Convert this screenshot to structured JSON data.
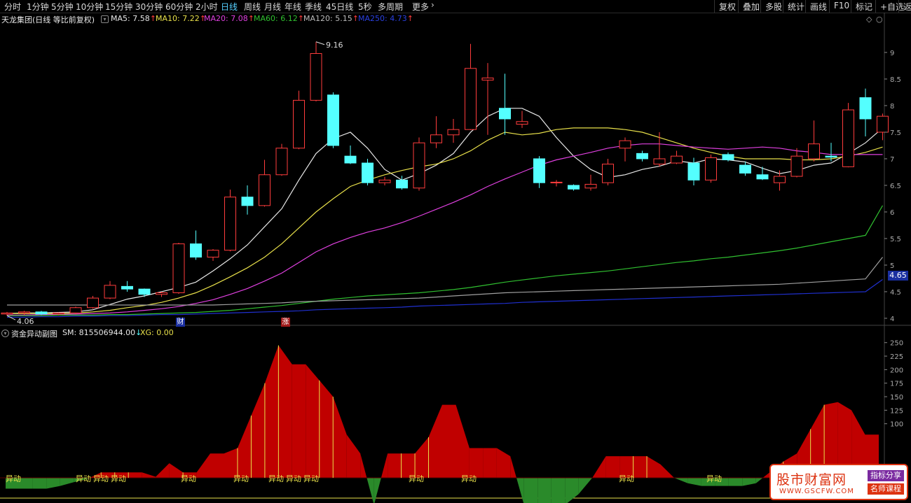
{
  "toolbar": {
    "periods": [
      "分时",
      "1分钟",
      "5分钟",
      "10分钟",
      "15分钟",
      "30分钟",
      "60分钟",
      "2小时",
      "日线",
      "周线",
      "月线",
      "年线",
      "季线",
      "45日线",
      "5秒",
      "多周期",
      "更多"
    ],
    "active_period": "日线",
    "right_buttons": [
      "复权",
      "叠加",
      "多股",
      "统计",
      "画线",
      "F10",
      "标记",
      "+自选",
      "返"
    ]
  },
  "legend": {
    "stock": "天龙集团(日线 等比前复权)",
    "ma5": "MA5: 7.58",
    "ma10": "MA10: 7.22",
    "ma20": "MA20: 7.08",
    "ma60": "MA60: 6.12",
    "ma120": "MA120: 5.15",
    "ma250": "MA250: 4.73",
    "up_arrow": "↑"
  },
  "annotations": {
    "high_label": "9.16",
    "low_label": "4.06",
    "price_tag": "4.65",
    "flag_cai": "财",
    "flag_zhang": "涨"
  },
  "sub_legend": {
    "name": "资金异动副图",
    "sm": "SM: 815506944.00",
    "sm_arrow": "↓",
    "xg": "XG: 0.00"
  },
  "signal_label": "异动",
  "watermark": {
    "title": "股市财富网",
    "url": "WWW.GSCFW.COM",
    "tag1": "指标分享",
    "tag2": "名师课程"
  },
  "colors": {
    "up": "#ff3c3c",
    "down": "#54ffff",
    "ma5": "#e8e8e8",
    "ma10": "#e8e04a",
    "ma20": "#e040e0",
    "ma60": "#30c030",
    "ma120": "#a0a0a0",
    "ma250": "#2030d0",
    "area_pos": "#c00000",
    "area_neg": "#2a8a2a"
  },
  "chart_data": [
    {
      "type": "candlestick",
      "title": "天龙集团(日线 等比前复权)",
      "y_ticks": [
        9,
        8.5,
        8,
        7.5,
        7,
        6.5,
        6,
        5.5,
        5,
        4.5,
        4
      ],
      "ylim": [
        3.96,
        9.46
      ],
      "candles": [
        [
          4.08,
          4.12,
          4.05,
          4.1
        ],
        [
          4.1,
          4.14,
          4.06,
          4.12
        ],
        [
          4.12,
          4.14,
          4.06,
          4.08
        ],
        [
          4.08,
          4.11,
          4.06,
          4.1
        ],
        [
          4.1,
          4.22,
          4.08,
          4.2
        ],
        [
          4.2,
          4.42,
          4.18,
          4.38
        ],
        [
          4.38,
          4.7,
          4.36,
          4.62
        ],
        [
          4.6,
          4.7,
          4.5,
          4.55
        ],
        [
          4.55,
          4.56,
          4.4,
          4.45
        ],
        [
          4.45,
          4.5,
          4.4,
          4.48
        ],
        [
          4.48,
          5.42,
          4.46,
          5.4
        ],
        [
          5.4,
          5.65,
          5.1,
          5.15
        ],
        [
          5.15,
          5.3,
          5.08,
          5.28
        ],
        [
          5.28,
          6.42,
          5.26,
          6.28
        ],
        [
          6.28,
          6.5,
          5.95,
          6.12
        ],
        [
          6.12,
          6.98,
          6.1,
          6.7
        ],
        [
          6.7,
          7.28,
          6.68,
          7.2
        ],
        [
          7.2,
          8.28,
          7.18,
          8.1
        ],
        [
          8.1,
          9.2,
          8.08,
          8.98
        ],
        [
          8.2,
          8.25,
          7.2,
          7.25
        ],
        [
          7.05,
          7.25,
          6.9,
          6.92
        ],
        [
          6.92,
          7.0,
          6.5,
          6.55
        ],
        [
          6.55,
          6.66,
          6.5,
          6.6
        ],
        [
          6.6,
          6.68,
          6.42,
          6.45
        ],
        [
          6.45,
          7.4,
          6.4,
          7.3
        ],
        [
          7.3,
          7.8,
          7.2,
          7.45
        ],
        [
          7.45,
          7.75,
          7.3,
          7.55
        ],
        [
          7.55,
          9.16,
          7.54,
          8.7
        ],
        [
          8.48,
          8.8,
          7.45,
          8.52
        ],
        [
          7.95,
          8.6,
          7.45,
          7.75
        ],
        [
          7.65,
          7.9,
          7.58,
          7.7
        ],
        [
          7.0,
          7.05,
          6.45,
          6.55
        ],
        [
          6.55,
          6.6,
          6.48,
          6.56
        ],
        [
          6.5,
          6.52,
          6.4,
          6.43
        ],
        [
          6.45,
          6.7,
          6.4,
          6.52
        ],
        [
          6.55,
          7.0,
          6.5,
          6.9
        ],
        [
          7.2,
          7.4,
          6.95,
          7.34
        ],
        [
          7.1,
          7.15,
          6.95,
          7.0
        ],
        [
          6.9,
          7.5,
          6.85,
          7.0
        ],
        [
          6.92,
          7.15,
          6.9,
          7.05
        ],
        [
          6.92,
          7.02,
          6.5,
          6.6
        ],
        [
          6.6,
          7.08,
          6.55,
          7.02
        ],
        [
          7.08,
          7.12,
          6.95,
          6.98
        ],
        [
          6.88,
          6.95,
          6.68,
          6.73
        ],
        [
          6.7,
          6.85,
          6.6,
          6.62
        ],
        [
          6.55,
          6.78,
          6.4,
          6.67
        ],
        [
          6.67,
          7.2,
          6.65,
          7.05
        ],
        [
          7.0,
          7.72,
          6.95,
          7.28
        ],
        [
          7.05,
          7.3,
          6.95,
          7.03
        ],
        [
          6.85,
          8.05,
          6.84,
          7.92
        ],
        [
          8.15,
          8.32,
          7.42,
          7.75
        ],
        [
          7.5,
          7.85,
          7.35,
          7.8
        ]
      ],
      "ma": {
        "MA5": [
          4.09,
          4.1,
          4.1,
          4.11,
          4.12,
          4.16,
          4.26,
          4.36,
          4.42,
          4.5,
          4.58,
          4.68,
          4.89,
          5.12,
          5.38,
          5.72,
          6.06,
          6.6,
          7.1,
          7.38,
          7.5,
          7.2,
          6.8,
          6.6,
          6.72,
          6.88,
          7.1,
          7.5,
          7.8,
          7.95,
          7.95,
          7.8,
          7.4,
          7.05,
          6.8,
          6.65,
          6.7,
          6.8,
          6.86,
          6.96,
          6.92,
          7.0,
          6.98,
          6.94,
          6.82,
          6.72,
          6.78,
          6.88,
          6.92,
          7.1,
          7.3,
          7.58
        ],
        "MA10": [
          4.09,
          4.09,
          4.09,
          4.09,
          4.1,
          4.12,
          4.15,
          4.2,
          4.24,
          4.3,
          4.38,
          4.48,
          4.62,
          4.78,
          4.95,
          5.15,
          5.4,
          5.7,
          6.0,
          6.25,
          6.48,
          6.6,
          6.7,
          6.78,
          6.85,
          6.9,
          7.0,
          7.15,
          7.35,
          7.5,
          7.45,
          7.48,
          7.55,
          7.58,
          7.58,
          7.58,
          7.55,
          7.5,
          7.4,
          7.3,
          7.2,
          7.12,
          7.05,
          7.0,
          7.0,
          7.0,
          6.98,
          6.98,
          7.0,
          7.05,
          7.12,
          7.22
        ],
        "MA20": [
          4.06,
          4.06,
          4.07,
          4.07,
          4.08,
          4.09,
          4.1,
          4.12,
          4.15,
          4.18,
          4.22,
          4.28,
          4.35,
          4.45,
          4.56,
          4.7,
          4.85,
          5.05,
          5.25,
          5.4,
          5.52,
          5.62,
          5.7,
          5.8,
          5.92,
          6.05,
          6.18,
          6.32,
          6.48,
          6.62,
          6.75,
          6.88,
          6.98,
          7.05,
          7.12,
          7.2,
          7.25,
          7.28,
          7.28,
          7.25,
          7.22,
          7.2,
          7.18,
          7.2,
          7.22,
          7.2,
          7.15,
          7.12,
          7.08,
          7.08,
          7.08,
          7.08
        ],
        "MA60": [
          4.05,
          4.05,
          4.05,
          4.06,
          4.06,
          4.06,
          4.07,
          4.07,
          4.08,
          4.09,
          4.1,
          4.11,
          4.13,
          4.15,
          4.18,
          4.21,
          4.24,
          4.28,
          4.32,
          4.36,
          4.39,
          4.42,
          4.44,
          4.46,
          4.48,
          4.51,
          4.54,
          4.58,
          4.63,
          4.68,
          4.72,
          4.76,
          4.8,
          4.83,
          4.86,
          4.89,
          4.93,
          4.97,
          5.01,
          5.05,
          5.08,
          5.12,
          5.15,
          5.19,
          5.23,
          5.27,
          5.32,
          5.38,
          5.44,
          5.5,
          5.56,
          6.12
        ],
        "MA120": [
          4.25,
          4.25,
          4.25,
          4.25,
          4.25,
          4.25,
          4.25,
          4.25,
          4.25,
          4.25,
          4.25,
          4.25,
          4.25,
          4.26,
          4.27,
          4.28,
          4.29,
          4.31,
          4.32,
          4.33,
          4.34,
          4.35,
          4.36,
          4.37,
          4.38,
          4.4,
          4.42,
          4.44,
          4.46,
          4.48,
          4.49,
          4.5,
          4.51,
          4.52,
          4.53,
          4.54,
          4.55,
          4.56,
          4.57,
          4.58,
          4.59,
          4.6,
          4.61,
          4.62,
          4.63,
          4.64,
          4.66,
          4.68,
          4.7,
          4.72,
          4.74,
          5.15
        ],
        "MA250": [
          4.02,
          4.02,
          4.03,
          4.03,
          4.04,
          4.04,
          4.05,
          4.05,
          4.06,
          4.07,
          4.07,
          4.08,
          4.09,
          4.1,
          4.11,
          4.12,
          4.13,
          4.14,
          4.16,
          4.17,
          4.18,
          4.19,
          4.2,
          4.21,
          4.23,
          4.24,
          4.25,
          4.26,
          4.27,
          4.28,
          4.3,
          4.31,
          4.32,
          4.33,
          4.34,
          4.35,
          4.36,
          4.37,
          4.38,
          4.39,
          4.4,
          4.41,
          4.42,
          4.43,
          4.44,
          4.45,
          4.46,
          4.47,
          4.48,
          4.49,
          4.5,
          4.73
        ]
      }
    },
    {
      "type": "area",
      "title": "资金异动副图",
      "y_ticks": [
        250,
        225,
        200,
        175,
        150,
        125,
        100
      ],
      "ylim": [
        -50,
        260
      ],
      "values": [
        -20,
        -20,
        -20,
        -20,
        -15,
        -8,
        -2,
        10,
        10,
        10,
        10,
        2,
        27,
        10,
        10,
        45,
        45,
        55,
        115,
        175,
        245,
        210,
        210,
        180,
        150,
        80,
        45,
        -50,
        45,
        45,
        45,
        75,
        135,
        135,
        55,
        55,
        55,
        40,
        -50,
        -50,
        -50,
        -50,
        -30,
        0,
        40,
        40,
        40,
        40,
        25,
        0,
        -10,
        -15,
        -15,
        -15,
        -15,
        -10,
        10,
        30,
        45,
        90,
        135,
        140,
        125,
        80,
        80
      ],
      "signal_bars": [
        7,
        8,
        9,
        13,
        17,
        18,
        19,
        20,
        23,
        24,
        27,
        29,
        30,
        31,
        38,
        42,
        46,
        47,
        53,
        57,
        59,
        60
      ],
      "signals": [
        0,
        4,
        5,
        6,
        10,
        13,
        15,
        16,
        17,
        23,
        26,
        35,
        40
      ]
    }
  ]
}
